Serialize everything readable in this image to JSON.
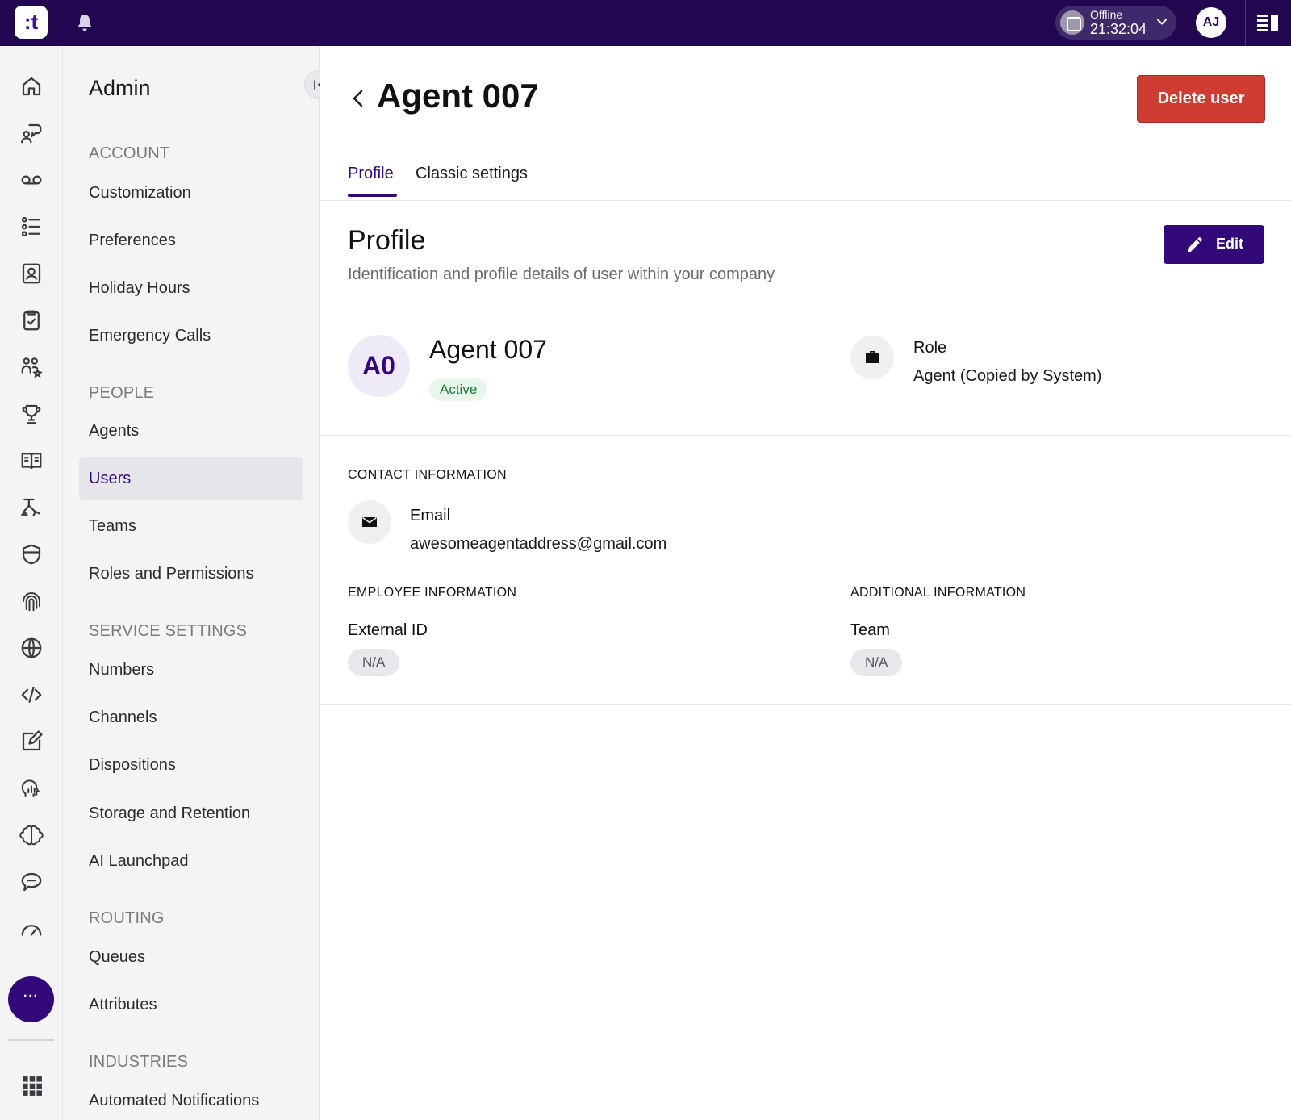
{
  "topbar": {
    "logo_text": ":t",
    "status_label": "Offline",
    "status_time": "21:32:04",
    "user_initials": "AJ"
  },
  "rail": {
    "icons": [
      "home-icon",
      "conversation-icon",
      "voicemail-icon",
      "list-icon",
      "contacts-icon",
      "clipboard-check-icon",
      "people-star-icon",
      "trophy-icon",
      "book-icon",
      "flow-icon",
      "shield-icon",
      "fingerprint-icon",
      "globe-icon",
      "code-icon",
      "edit-square-icon",
      "analytics-head-icon",
      "brain-icon",
      "chat-bubble-icon",
      "gauge-icon"
    ],
    "more_label": "···"
  },
  "sidebar": {
    "title": "Admin",
    "sections": [
      {
        "heading": "ACCOUNT",
        "items": [
          "Customization",
          "Preferences",
          "Holiday Hours",
          "Emergency Calls"
        ]
      },
      {
        "heading": "PEOPLE",
        "items": [
          "Agents",
          "Users",
          "Teams",
          "Roles and Permissions"
        ]
      },
      {
        "heading": "SERVICE SETTINGS",
        "items": [
          "Numbers",
          "Channels",
          "Dispositions",
          "Storage and Retention",
          "AI Launchpad"
        ]
      },
      {
        "heading": "ROUTING",
        "items": [
          "Queues",
          "Attributes"
        ]
      },
      {
        "heading": "INDUSTRIES",
        "items": [
          "Automated Notifications"
        ]
      }
    ],
    "active_item": "Users"
  },
  "main": {
    "title": "Agent 007",
    "delete_label": "Delete user",
    "tabs": [
      {
        "label": "Profile",
        "active": true
      },
      {
        "label": "Classic settings",
        "active": false
      }
    ],
    "profile": {
      "title": "Profile",
      "subtitle": "Identification and profile details of user within your company",
      "edit_label": "Edit",
      "avatar_initials": "A0",
      "name": "Agent 007",
      "status": "Active",
      "role_label": "Role",
      "role_value": "Agent (Copied by System)"
    },
    "contact": {
      "heading": "CONTACT INFORMATION",
      "email_label": "Email",
      "email_value": "awesomeagentaddress@gmail.com"
    },
    "employee": {
      "heading": "EMPLOYEE INFORMATION",
      "external_id_label": "External ID",
      "external_id_value": "N/A"
    },
    "additional": {
      "heading": "ADDITIONAL INFORMATION",
      "team_label": "Team",
      "team_value": "N/A"
    }
  },
  "colors": {
    "topbar": "#22064f",
    "accent": "#33097a",
    "danger": "#cf3d32",
    "success": "#1e7a3c"
  }
}
